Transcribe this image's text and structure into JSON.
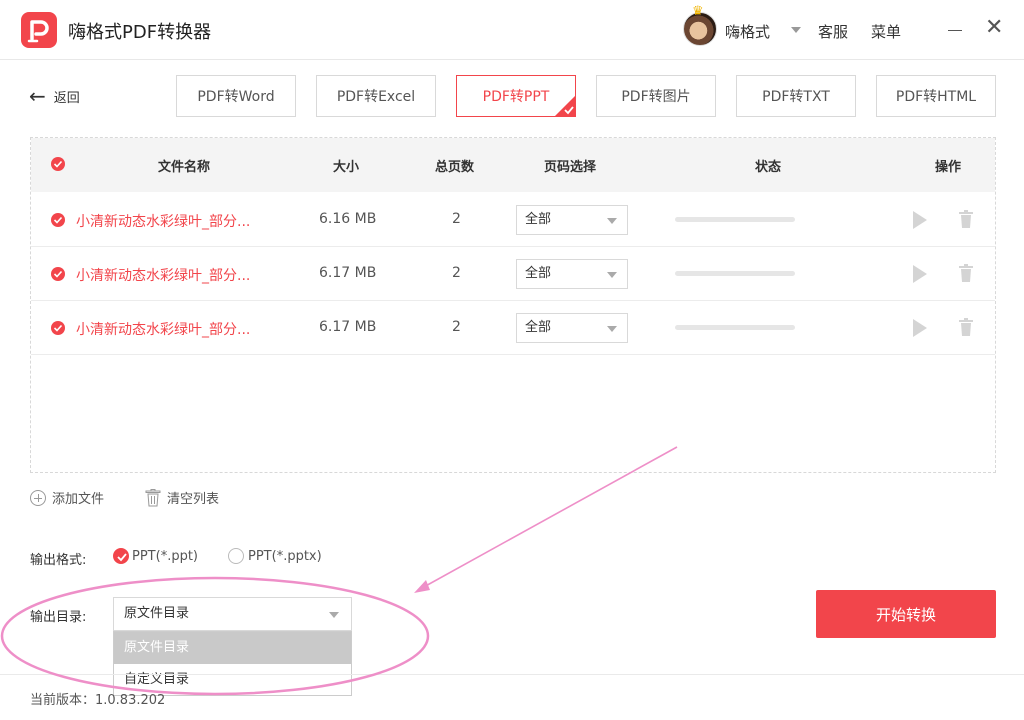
{
  "app": {
    "title": "嗨格式PDF转换器"
  },
  "header": {
    "username": "嗨格式",
    "service_label": "客服",
    "menu_label": "菜单"
  },
  "nav": {
    "back_label": "返回"
  },
  "tabs": [
    {
      "label": "PDF转Word",
      "active": false
    },
    {
      "label": "PDF转Excel",
      "active": false
    },
    {
      "label": "PDF转PPT",
      "active": true
    },
    {
      "label": "PDF转图片",
      "active": false
    },
    {
      "label": "PDF转TXT",
      "active": false
    },
    {
      "label": "PDF转HTML",
      "active": false
    }
  ],
  "table": {
    "headers": {
      "name": "文件名称",
      "size": "大小",
      "pages": "总页数",
      "range": "页码选择",
      "status": "状态",
      "actions": "操作"
    },
    "rows": [
      {
        "name": "小清新动态水彩绿叶_部分...",
        "size": "6.16 MB",
        "pages": "2",
        "range": "全部",
        "progress": 0
      },
      {
        "name": "小清新动态水彩绿叶_部分...",
        "size": "6.17 MB",
        "pages": "2",
        "range": "全部",
        "progress": 0
      },
      {
        "name": "小清新动态水彩绿叶_部分...",
        "size": "6.17 MB",
        "pages": "2",
        "range": "全部",
        "progress": 0
      }
    ]
  },
  "actions": {
    "add_file": "添加文件",
    "clear_list": "清空列表"
  },
  "output_format": {
    "label": "输出格式:",
    "options": [
      {
        "label": "PPT(*.ppt)",
        "selected": true
      },
      {
        "label": "PPT(*.pptx)",
        "selected": false
      }
    ]
  },
  "output_dir": {
    "label": "输出目录:",
    "selected": "原文件目录",
    "options": [
      "原文件目录",
      "自定义目录"
    ]
  },
  "start_button": "开始转换",
  "footer": {
    "version_text": "当前版本：1.0.83.202"
  },
  "colors": {
    "accent": "#f2454b",
    "annotation": "#ee8fc8"
  }
}
